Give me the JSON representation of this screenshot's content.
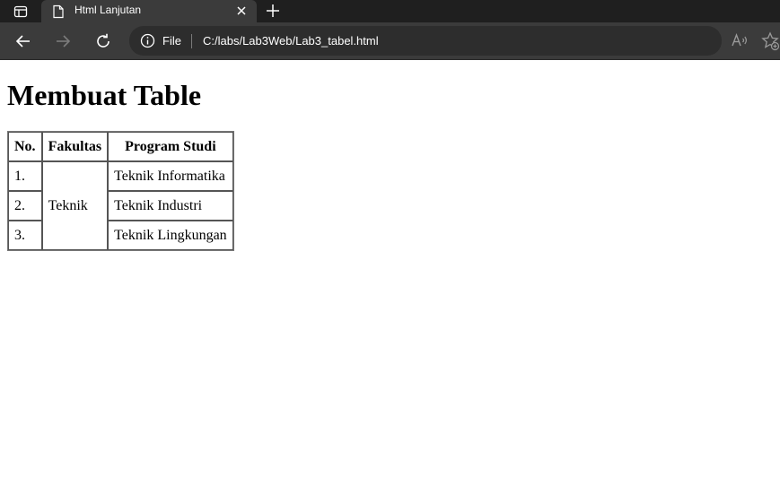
{
  "browser": {
    "tab": {
      "title": "Html Lanjutan"
    },
    "address_bar": {
      "site_label": "File",
      "url": "C:/labs/Lab3Web/Lab3_tabel.html"
    },
    "icons": {
      "tab_actions": "tab-actions-icon",
      "page": "page-icon",
      "close": "close-icon",
      "new_tab": "plus-icon",
      "back": "back-arrow-icon",
      "forward": "forward-arrow-icon",
      "refresh": "refresh-icon",
      "info": "info-icon",
      "read_aloud": "read-aloud-icon",
      "favorites": "add-favorite-icon"
    },
    "colors": {
      "tabstrip": "#1f1f1f",
      "toolbar": "#3b3b3b",
      "omnibox": "#2d2d2d"
    }
  },
  "page": {
    "heading": "Membuat Table",
    "table": {
      "headers": [
        "No.",
        "Fakultas",
        "Program Studi"
      ],
      "rows": [
        {
          "no": "1.",
          "program": "Teknik Informatika"
        },
        {
          "no": "2.",
          "program": "Teknik Industri"
        },
        {
          "no": "3.",
          "program": "Teknik Lingkungan"
        }
      ],
      "faculty": "Teknik"
    }
  }
}
